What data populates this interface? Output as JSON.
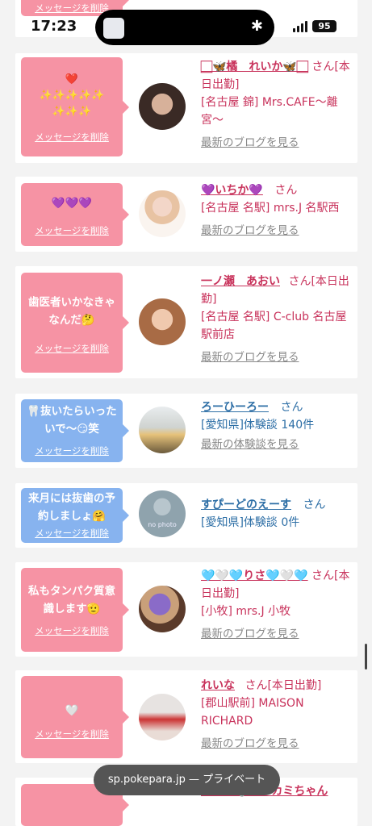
{
  "status": {
    "time": "17:23",
    "battery": "95"
  },
  "delete_label": "メッセージを削除",
  "top_partial": {
    "delete_label": "メッセージを削除"
  },
  "cards": [
    {
      "message": "❤️\n✨✨✨✨✨\n✨✨✨",
      "name": "🏻🦋橘　れいか🦋🏻",
      "san": "さん",
      "status": "[本日出勤]",
      "detail": "[名古屋 錦] Mrs.CAFE〜離宮〜",
      "link": "最新のブログを見る",
      "bubble_color": "#f693a4"
    },
    {
      "message": "💜💜💜",
      "name": "💜いちか💜",
      "san": "さん",
      "status": "",
      "detail": "[名古屋 名駅] mrs.J 名駅西",
      "link": "最新のブログを見る",
      "bubble_color": "#f693a4"
    },
    {
      "message": "歯医者いかなきゃなんだ🤔",
      "name": "一ノ瀬　あおい",
      "san": "さん",
      "status": "[本日出勤]",
      "detail": "[名古屋 名駅] C-club 名古屋駅前店",
      "link": "最新のブログを見る",
      "bubble_color": "#f693a4"
    },
    {
      "message": "🦷抜いたらいったいで〜😏笑",
      "name": "ろーひーろー",
      "san": "さん",
      "status": "",
      "detail": "[愛知県]体験談 140件",
      "link": "最新の体験談を見る",
      "bubble_color": "#87b3ef"
    },
    {
      "message": "来月には抜歯の予約しましょ🤗",
      "name": "すぴーどのえーす",
      "san": "さん",
      "status": "",
      "detail": "[愛知県]体験談 0件",
      "link": "",
      "avatar_text": "no photo",
      "bubble_color": "#87b3ef"
    },
    {
      "message": "私もタンパク質意識します🫡",
      "name": "🩵🤍🩵りさ🩵🤍🩵",
      "san": "さん",
      "status": "[本日出勤]",
      "detail": "[小牧] mrs.J 小牧",
      "link": "最新のブログを見る",
      "bubble_color": "#f693a4"
    },
    {
      "message": "🤍",
      "name": "れいな",
      "san": "さん",
      "status": "[本日出勤]",
      "detail": "[郡山駅前] MAISON RICHARD",
      "link": "最新のブログを見る",
      "bubble_color": "#f693a4"
    },
    {
      "message": "",
      "name": "ゆうあ🐺オオカミちゃん",
      "san": "",
      "status": "",
      "detail": "",
      "link": "",
      "bubble_color": "#f693a4"
    }
  ],
  "url_bar": "sp.pokepara.jp — プライベート"
}
